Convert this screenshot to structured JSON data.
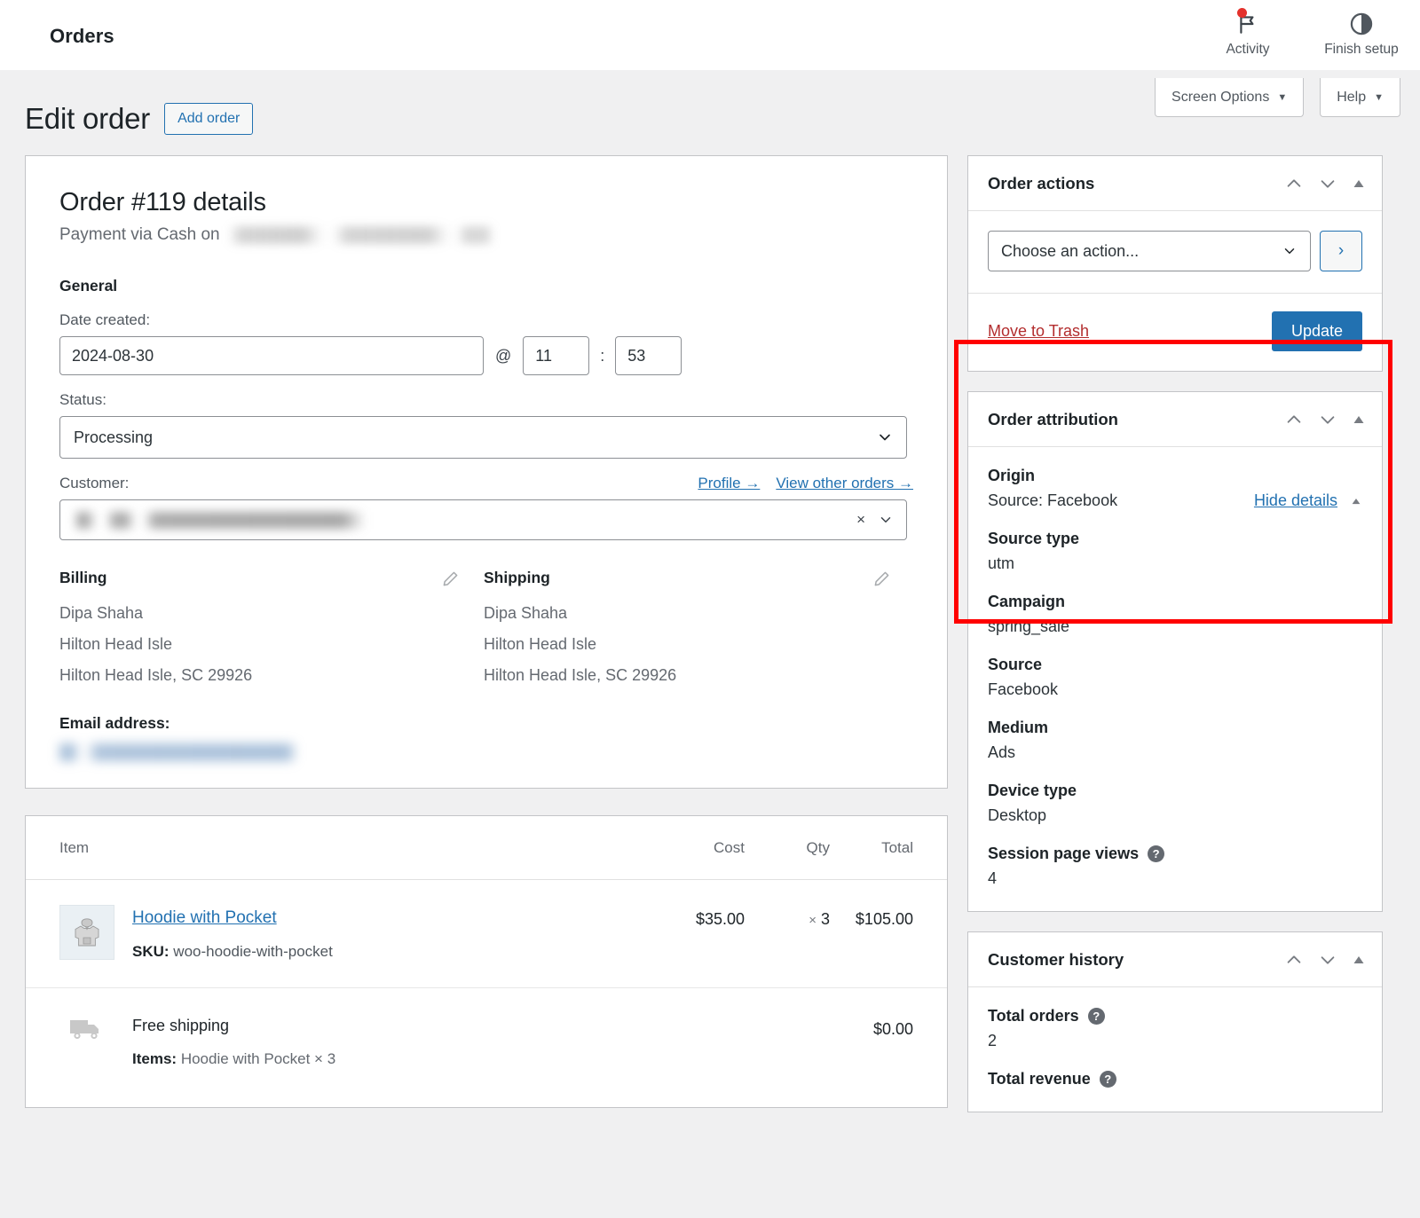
{
  "topbar": {
    "title": "Orders",
    "items": [
      {
        "label": "Activity",
        "icon": "flag-icon",
        "badge": true
      },
      {
        "label": "Finish setup",
        "icon": "progress-circle-icon",
        "badge": false
      }
    ]
  },
  "screen_buttons": {
    "screen_options": "Screen Options",
    "help": "Help",
    "caret": "▼"
  },
  "page": {
    "title": "Edit order",
    "add_order": "Add order"
  },
  "order": {
    "heading": "Order #119 details",
    "payment_prefix": "Payment via Cash on",
    "general_label": "General",
    "date_label": "Date created:",
    "date_value": "2024-08-30",
    "at_symbol": "@",
    "hour": "11",
    "colon": ":",
    "minute": "53",
    "status_label": "Status:",
    "status_value": "Processing",
    "customer_label": "Customer:",
    "profile_link": "Profile →",
    "view_orders_link": "View other orders →",
    "clear_symbol": "×"
  },
  "billing": {
    "title": "Billing",
    "name": "Dipa Shaha",
    "line1": "Hilton Head Isle",
    "line2": "Hilton Head Isle, SC 29926",
    "email_label": "Email address:"
  },
  "shipping": {
    "title": "Shipping",
    "name": "Dipa Shaha",
    "line1": "Hilton Head Isle",
    "line2": "Hilton Head Isle, SC 29926"
  },
  "items_table": {
    "columns": {
      "item": "Item",
      "cost": "Cost",
      "qty": "Qty",
      "total": "Total"
    },
    "rows": [
      {
        "name": "Hoodie with Pocket",
        "sku_label": "SKU:",
        "sku": "woo-hoodie-with-pocket",
        "cost": "$35.00",
        "qty_x": "×",
        "qty": "3",
        "total": "$105.00"
      }
    ],
    "shipping_row": {
      "name": "Free shipping",
      "items_label": "Items:",
      "items_value": "Hoodie with Pocket × 3",
      "total": "$0.00"
    }
  },
  "order_actions": {
    "title": "Order actions",
    "action_placeholder": "Choose an action...",
    "go_symbol": "›",
    "trash_label": "Move to Trash",
    "update_label": "Update"
  },
  "order_attribution": {
    "title": "Order attribution",
    "origin_label": "Origin",
    "origin_value": "Source: Facebook",
    "hide_details": "Hide details",
    "fields": [
      {
        "label": "Source type",
        "value": "utm",
        "help": false
      },
      {
        "label": "Campaign",
        "value": "spring_sale",
        "help": false
      },
      {
        "label": "Source",
        "value": "Facebook",
        "help": false
      },
      {
        "label": "Medium",
        "value": "Ads",
        "help": false
      },
      {
        "label": "Device type",
        "value": "Desktop",
        "help": false
      },
      {
        "label": "Session page views",
        "value": "4",
        "help": true
      }
    ]
  },
  "customer_history": {
    "title": "Customer history",
    "fields": [
      {
        "label": "Total orders",
        "value": "2",
        "help": true
      },
      {
        "label": "Total revenue",
        "value": "",
        "help": true
      }
    ]
  },
  "colors": {
    "accent": "#2271b1",
    "danger": "#b32d2e",
    "annotation": "#ff0000",
    "badge": "#e4312b"
  },
  "help_glyph": "?"
}
